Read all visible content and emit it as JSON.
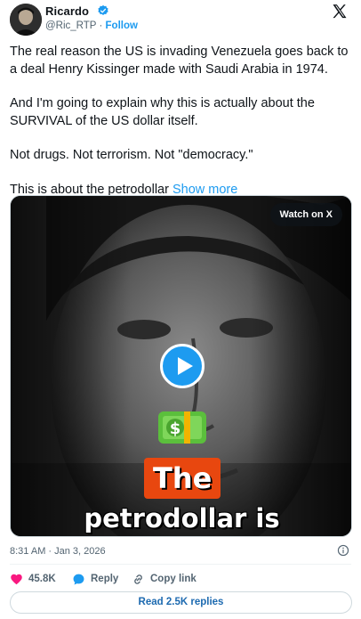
{
  "author": {
    "name": "Ricardo",
    "handle": "@Ric_RTP",
    "separator": "·",
    "follow_label": "Follow",
    "verified": true
  },
  "tweet": {
    "paragraphs": [
      "The real reason the US is invading Venezuela goes back to a deal Henry Kissinger made with Saudi Arabia in 1974.",
      "And I'm going to explain why this is actually about the SURVIVAL of the US dollar itself.",
      "Not drugs. Not terrorism. Not \"democracy.\""
    ],
    "last_paragraph": "This is about the petrodollar",
    "show_more": "Show more"
  },
  "media": {
    "watch_label": "Watch on X",
    "caption_line1": "The",
    "caption_line2": "petrodollar is",
    "emoji_icon": "money-banknote-icon"
  },
  "meta": {
    "timestamp": "8:31 AM · Jan 3, 2026"
  },
  "actions": {
    "likes": "45.8K",
    "reply_label": "Reply",
    "copy_label": "Copy link",
    "read_replies": "Read 2.5K replies"
  },
  "colors": {
    "accent": "#1d9bf0",
    "like": "#f91880",
    "text": "#0f1419",
    "muted": "#536471",
    "caption_bg": "#e8470f"
  }
}
